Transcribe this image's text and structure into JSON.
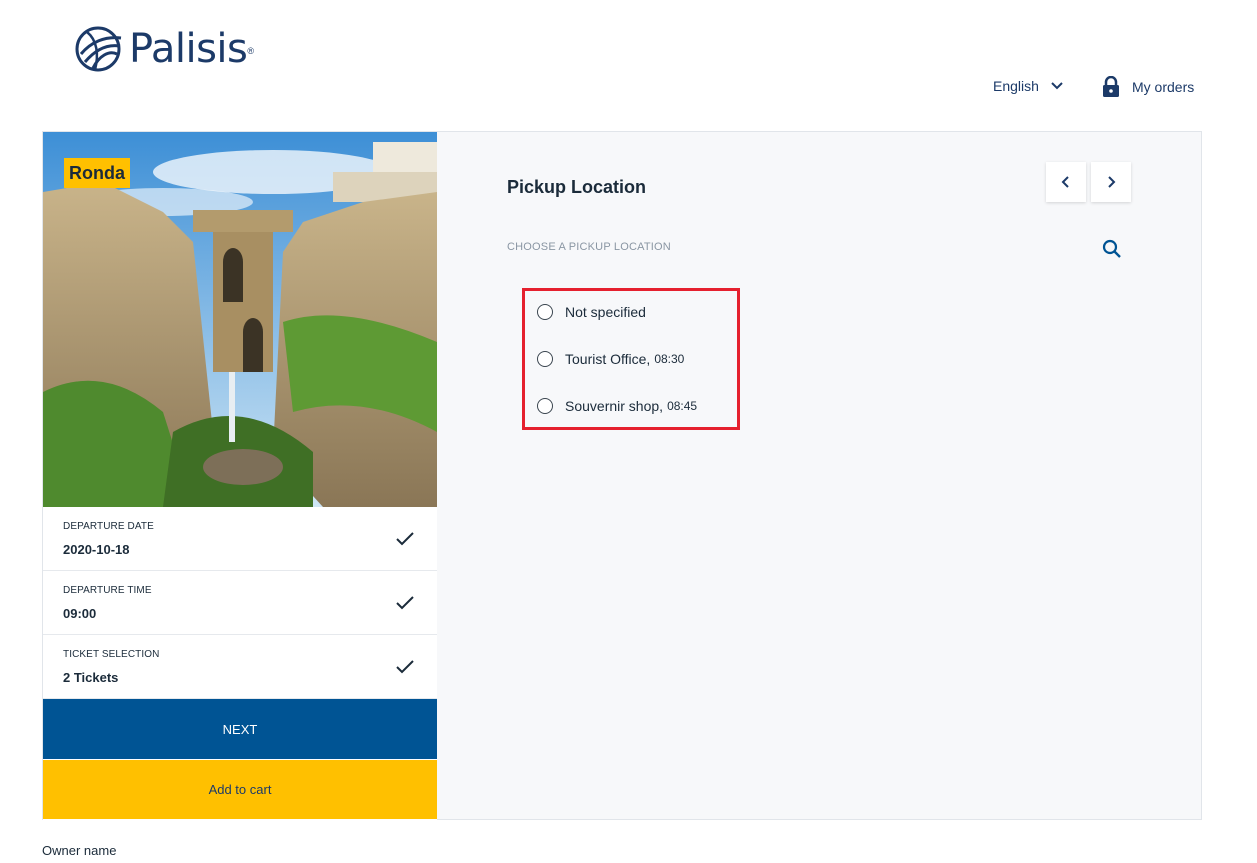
{
  "brand": {
    "name": "Palisis",
    "reg": "®"
  },
  "header": {
    "language": "English",
    "orders_label": "My orders"
  },
  "tour": {
    "name": "Ronda"
  },
  "steps": [
    {
      "label": "DEPARTURE DATE",
      "value": "2020-10-18"
    },
    {
      "label": "DEPARTURE TIME",
      "value": "09:00"
    },
    {
      "label": "TICKET SELECTION",
      "value": "2 Tickets"
    }
  ],
  "buttons": {
    "next": "NEXT",
    "cart": "Add to cart"
  },
  "panel": {
    "title": "Pickup Location",
    "subheading": "CHOOSE A PICKUP LOCATION",
    "options": [
      {
        "name": "Not specified",
        "time": ""
      },
      {
        "name": "Tourist Office,",
        "time": "08:30"
      },
      {
        "name": "Souvernir shop,",
        "time": "08:45"
      }
    ]
  },
  "footer": {
    "owner_label": "Owner name"
  },
  "colors": {
    "brand_blue": "#005494",
    "accent_yellow": "#ffc000",
    "highlight_red": "#e5202e",
    "logo_navy": "#1c3a68"
  }
}
